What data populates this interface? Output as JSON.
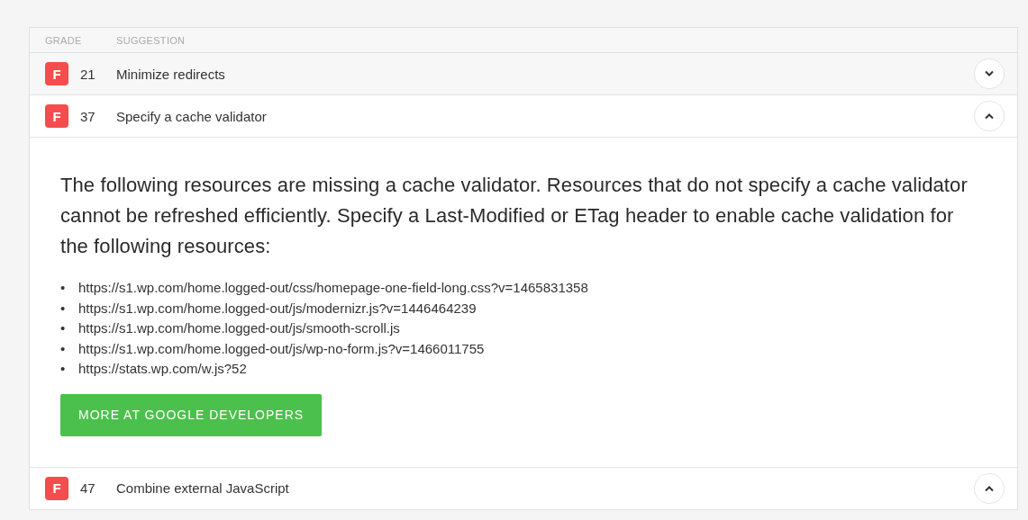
{
  "table": {
    "columns": [
      "GRADE",
      "SUGGESTION"
    ],
    "rows": [
      {
        "grade": "F",
        "score": "21",
        "suggestion": "Minimize redirects",
        "expanded": false
      },
      {
        "grade": "F",
        "score": "37",
        "suggestion": "Specify a cache validator",
        "expanded": true,
        "detail": {
          "description": "The following resources are missing a cache validator. Resources that do not specify a cache validator cannot be refreshed efficiently. Specify a Last-Modified or ETag header to enable cache validation for the following resources:",
          "bullet": "•",
          "resources": [
            "https://s1.wp.com/home.logged-out/css/homepage-one-field-long.css?v=1465831358",
            "https://s1.wp.com/home.logged-out/js/modernizr.js?v=1446464239",
            "https://s1.wp.com/home.logged-out/js/smooth-scroll.js",
            "https://s1.wp.com/home.logged-out/js/wp-no-form.js?v=1466011755",
            "https://stats.wp.com/w.js?52"
          ],
          "button": "MORE AT GOOGLE DEVELOPERS"
        }
      },
      {
        "grade": "F",
        "score": "47",
        "suggestion": "Combine external JavaScript",
        "expanded": true
      }
    ]
  }
}
